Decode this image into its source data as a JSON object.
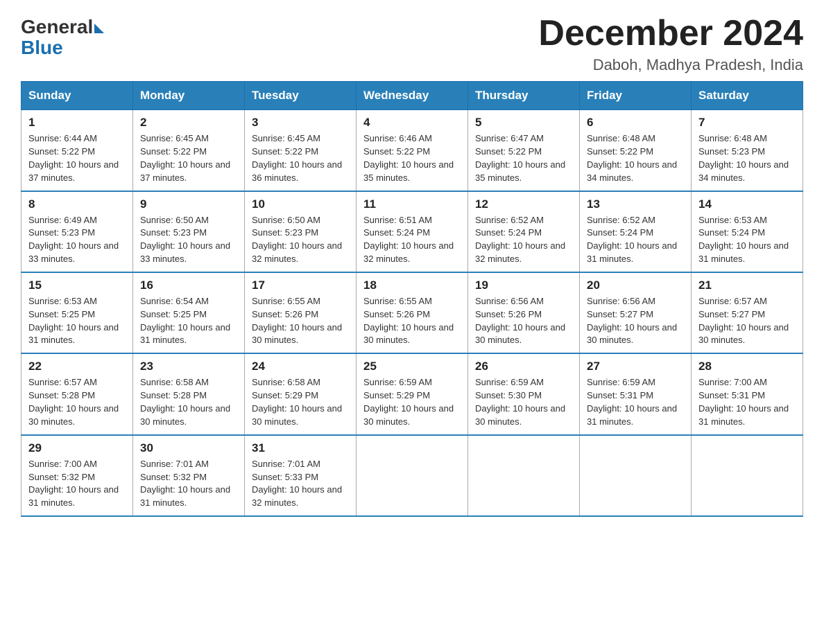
{
  "logo": {
    "general": "General",
    "blue": "Blue",
    "arrow": "▶"
  },
  "title": "December 2024",
  "location": "Daboh, Madhya Pradesh, India",
  "days_of_week": [
    "Sunday",
    "Monday",
    "Tuesday",
    "Wednesday",
    "Thursday",
    "Friday",
    "Saturday"
  ],
  "weeks": [
    [
      {
        "num": "1",
        "sunrise": "6:44 AM",
        "sunset": "5:22 PM",
        "daylight": "10 hours and 37 minutes."
      },
      {
        "num": "2",
        "sunrise": "6:45 AM",
        "sunset": "5:22 PM",
        "daylight": "10 hours and 37 minutes."
      },
      {
        "num": "3",
        "sunrise": "6:45 AM",
        "sunset": "5:22 PM",
        "daylight": "10 hours and 36 minutes."
      },
      {
        "num": "4",
        "sunrise": "6:46 AM",
        "sunset": "5:22 PM",
        "daylight": "10 hours and 35 minutes."
      },
      {
        "num": "5",
        "sunrise": "6:47 AM",
        "sunset": "5:22 PM",
        "daylight": "10 hours and 35 minutes."
      },
      {
        "num": "6",
        "sunrise": "6:48 AM",
        "sunset": "5:22 PM",
        "daylight": "10 hours and 34 minutes."
      },
      {
        "num": "7",
        "sunrise": "6:48 AM",
        "sunset": "5:23 PM",
        "daylight": "10 hours and 34 minutes."
      }
    ],
    [
      {
        "num": "8",
        "sunrise": "6:49 AM",
        "sunset": "5:23 PM",
        "daylight": "10 hours and 33 minutes."
      },
      {
        "num": "9",
        "sunrise": "6:50 AM",
        "sunset": "5:23 PM",
        "daylight": "10 hours and 33 minutes."
      },
      {
        "num": "10",
        "sunrise": "6:50 AM",
        "sunset": "5:23 PM",
        "daylight": "10 hours and 32 minutes."
      },
      {
        "num": "11",
        "sunrise": "6:51 AM",
        "sunset": "5:24 PM",
        "daylight": "10 hours and 32 minutes."
      },
      {
        "num": "12",
        "sunrise": "6:52 AM",
        "sunset": "5:24 PM",
        "daylight": "10 hours and 32 minutes."
      },
      {
        "num": "13",
        "sunrise": "6:52 AM",
        "sunset": "5:24 PM",
        "daylight": "10 hours and 31 minutes."
      },
      {
        "num": "14",
        "sunrise": "6:53 AM",
        "sunset": "5:24 PM",
        "daylight": "10 hours and 31 minutes."
      }
    ],
    [
      {
        "num": "15",
        "sunrise": "6:53 AM",
        "sunset": "5:25 PM",
        "daylight": "10 hours and 31 minutes."
      },
      {
        "num": "16",
        "sunrise": "6:54 AM",
        "sunset": "5:25 PM",
        "daylight": "10 hours and 31 minutes."
      },
      {
        "num": "17",
        "sunrise": "6:55 AM",
        "sunset": "5:26 PM",
        "daylight": "10 hours and 30 minutes."
      },
      {
        "num": "18",
        "sunrise": "6:55 AM",
        "sunset": "5:26 PM",
        "daylight": "10 hours and 30 minutes."
      },
      {
        "num": "19",
        "sunrise": "6:56 AM",
        "sunset": "5:26 PM",
        "daylight": "10 hours and 30 minutes."
      },
      {
        "num": "20",
        "sunrise": "6:56 AM",
        "sunset": "5:27 PM",
        "daylight": "10 hours and 30 minutes."
      },
      {
        "num": "21",
        "sunrise": "6:57 AM",
        "sunset": "5:27 PM",
        "daylight": "10 hours and 30 minutes."
      }
    ],
    [
      {
        "num": "22",
        "sunrise": "6:57 AM",
        "sunset": "5:28 PM",
        "daylight": "10 hours and 30 minutes."
      },
      {
        "num": "23",
        "sunrise": "6:58 AM",
        "sunset": "5:28 PM",
        "daylight": "10 hours and 30 minutes."
      },
      {
        "num": "24",
        "sunrise": "6:58 AM",
        "sunset": "5:29 PM",
        "daylight": "10 hours and 30 minutes."
      },
      {
        "num": "25",
        "sunrise": "6:59 AM",
        "sunset": "5:29 PM",
        "daylight": "10 hours and 30 minutes."
      },
      {
        "num": "26",
        "sunrise": "6:59 AM",
        "sunset": "5:30 PM",
        "daylight": "10 hours and 30 minutes."
      },
      {
        "num": "27",
        "sunrise": "6:59 AM",
        "sunset": "5:31 PM",
        "daylight": "10 hours and 31 minutes."
      },
      {
        "num": "28",
        "sunrise": "7:00 AM",
        "sunset": "5:31 PM",
        "daylight": "10 hours and 31 minutes."
      }
    ],
    [
      {
        "num": "29",
        "sunrise": "7:00 AM",
        "sunset": "5:32 PM",
        "daylight": "10 hours and 31 minutes."
      },
      {
        "num": "30",
        "sunrise": "7:01 AM",
        "sunset": "5:32 PM",
        "daylight": "10 hours and 31 minutes."
      },
      {
        "num": "31",
        "sunrise": "7:01 AM",
        "sunset": "5:33 PM",
        "daylight": "10 hours and 32 minutes."
      },
      null,
      null,
      null,
      null
    ]
  ]
}
